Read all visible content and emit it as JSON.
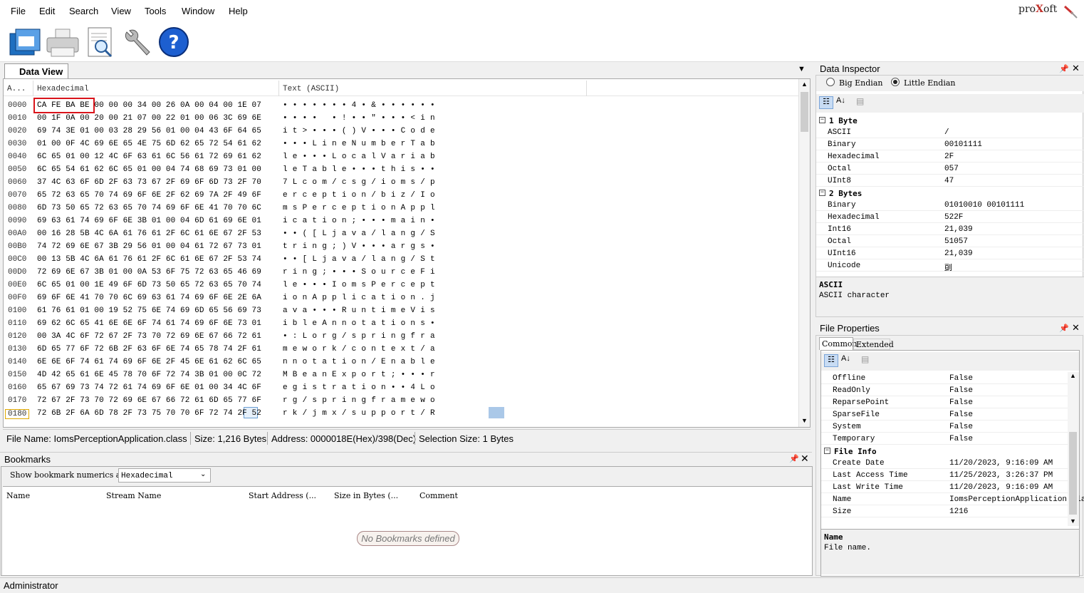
{
  "menu": [
    "File",
    "Edit",
    "Search",
    "View",
    "Tools",
    "Window",
    "Help"
  ],
  "logo": {
    "pre": "pro",
    "x": "X",
    "post": "oft"
  },
  "toolbar": [
    "open-icon",
    "print-icon",
    "preview-icon",
    "tools-icon",
    "help-icon"
  ],
  "dataview": {
    "tab": "Data View",
    "col_addr": "A...",
    "col_hex": "Hexadecimal",
    "col_text": "Text (ASCII)",
    "rows": [
      {
        "a": "0000",
        "h": "CA FE BA BE 00 00 00 34 00 26 0A 00 04 00 1E 07",
        "t": "• • • • • • • 4 • & • • • • • •"
      },
      {
        "a": "0010",
        "h": "00 1F 0A 00 20 00 21 07 00 22 01 00 06 3C 69 6E",
        "t": "• • • •   • ! • • \" • • • < i n"
      },
      {
        "a": "0020",
        "h": "69 74 3E 01 00 03 28 29 56 01 00 04 43 6F 64 65",
        "t": "i t > • • • ( ) V • • • C o d e"
      },
      {
        "a": "0030",
        "h": "01 00 0F 4C 69 6E 65 4E 75 6D 62 65 72 54 61 62",
        "t": "• • • L i n e N u m b e r T a b"
      },
      {
        "a": "0040",
        "h": "6C 65 01 00 12 4C 6F 63 61 6C 56 61 72 69 61 62",
        "t": "l e • • • L o c a l V a r i a b"
      },
      {
        "a": "0050",
        "h": "6C 65 54 61 62 6C 65 01 00 04 74 68 69 73 01 00",
        "t": "l e T a b l e • • • t h i s • •"
      },
      {
        "a": "0060",
        "h": "37 4C 63 6F 6D 2F 63 73 67 2F 69 6F 6D 73 2F 70",
        "t": "7 L c o m / c s g / i o m s / p"
      },
      {
        "a": "0070",
        "h": "65 72 63 65 70 74 69 6F 6E 2F 62 69 7A 2F 49 6F",
        "t": "e r c e p t i o n / b i z / I o"
      },
      {
        "a": "0080",
        "h": "6D 73 50 65 72 63 65 70 74 69 6F 6E 41 70 70 6C",
        "t": "m s P e r c e p t i o n A p p l"
      },
      {
        "a": "0090",
        "h": "69 63 61 74 69 6F 6E 3B 01 00 04 6D 61 69 6E 01",
        "t": "i c a t i o n ; • • • m a i n •"
      },
      {
        "a": "00A0",
        "h": "00 16 28 5B 4C 6A 61 76 61 2F 6C 61 6E 67 2F 53",
        "t": "• • ( [ L j a v a / l a n g / S"
      },
      {
        "a": "00B0",
        "h": "74 72 69 6E 67 3B 29 56 01 00 04 61 72 67 73 01",
        "t": "t r i n g ; ) V • • • a r g s •"
      },
      {
        "a": "00C0",
        "h": "00 13 5B 4C 6A 61 76 61 2F 6C 61 6E 67 2F 53 74",
        "t": "• • [ L j a v a / l a n g / S t"
      },
      {
        "a": "00D0",
        "h": "72 69 6E 67 3B 01 00 0A 53 6F 75 72 63 65 46 69",
        "t": "r i n g ; • • • S o u r c e F i"
      },
      {
        "a": "00E0",
        "h": "6C 65 01 00 1E 49 6F 6D 73 50 65 72 63 65 70 74",
        "t": "l e • • • I o m s P e r c e p t"
      },
      {
        "a": "00F0",
        "h": "69 6F 6E 41 70 70 6C 69 63 61 74 69 6F 6E 2E 6A",
        "t": "i o n A p p l i c a t i o n . j"
      },
      {
        "a": "0100",
        "h": "61 76 61 01 00 19 52 75 6E 74 69 6D 65 56 69 73",
        "t": "a v a • • • R u n t i m e V i s"
      },
      {
        "a": "0110",
        "h": "69 62 6C 65 41 6E 6E 6F 74 61 74 69 6F 6E 73 01",
        "t": "i b l e A n n o t a t i o n s •"
      },
      {
        "a": "0120",
        "h": "00 3A 4C 6F 72 67 2F 73 70 72 69 6E 67 66 72 61",
        "t": "• : L o r g / s p r i n g f r a"
      },
      {
        "a": "0130",
        "h": "6D 65 77 6F 72 6B 2F 63 6F 6E 74 65 78 74 2F 61",
        "t": "m e w o r k / c o n t e x t / a"
      },
      {
        "a": "0140",
        "h": "6E 6E 6F 74 61 74 69 6F 6E 2F 45 6E 61 62 6C 65",
        "t": "n n o t a t i o n / E n a b l e"
      },
      {
        "a": "0150",
        "h": "4D 42 65 61 6E 45 78 70 6F 72 74 3B 01 00 0C 72",
        "t": "M B e a n E x p o r t ; • • • r"
      },
      {
        "a": "0160",
        "h": "65 67 69 73 74 72 61 74 69 6F 6E 01 00 34 4C 6F",
        "t": "e g i s t r a t i o n • • 4 L o"
      },
      {
        "a": "0170",
        "h": "72 67 2F 73 70 72 69 6E 67 66 72 61 6D 65 77 6F",
        "t": "r g / s p r i n g f r a m e w o"
      },
      {
        "a": "0180",
        "h": "72 6B 2F 6A 6D 78 2F 73 75 70 70 6F 72 74 2F 52",
        "t": "r k / j m x / s u p p o r t / R"
      }
    ]
  },
  "status": {
    "filename": "File Name: IomsPerceptionApplication.class",
    "size": "Size: 1,216 Bytes",
    "address": "Address: 0000018E(Hex)/398(Dec)",
    "selection": "Selection Size: 1 Bytes"
  },
  "bookmarks": {
    "title": "Bookmarks",
    "show_label": "Show bookmark numerics as",
    "numerics_value": "Hexadecimal",
    "columns": [
      "Name",
      "Stream Name",
      "Start Address (...",
      "Size in Bytes (...",
      "Comment"
    ],
    "empty_text": "No Bookmarks defined"
  },
  "inspector": {
    "title": "Data Inspector",
    "big_endian": "Big Endian",
    "little_endian": "Little Endian",
    "group1": "1 Byte",
    "group1_rows": [
      [
        "ASCII",
        "/"
      ],
      [
        "Binary",
        "00101111"
      ],
      [
        "Hexadecimal",
        "2F"
      ],
      [
        "Octal",
        "057"
      ],
      [
        "UInt8",
        "47"
      ]
    ],
    "group2": "2 Bytes",
    "group2_rows": [
      [
        "Binary",
        "01010010 00101111"
      ],
      [
        "Hexadecimal",
        "522F"
      ],
      [
        "Int16",
        "21,039"
      ],
      [
        "Octal",
        "51057"
      ],
      [
        "UInt16",
        "21,039"
      ],
      [
        "Unicode",
        "刯"
      ]
    ],
    "desc_title": "ASCII",
    "desc_text": "ASCII character"
  },
  "fileprops": {
    "title": "File Properties",
    "tab_common": "Common",
    "tab_extended": "Extended",
    "rows": [
      [
        "Offline",
        "False"
      ],
      [
        "ReadOnly",
        "False"
      ],
      [
        "ReparsePoint",
        "False"
      ],
      [
        "SparseFile",
        "False"
      ],
      [
        "System",
        "False"
      ],
      [
        "Temporary",
        "False"
      ]
    ],
    "group": "File Info",
    "info_rows": [
      [
        "Create Date",
        "11/20/2023, 9:16:09 AM"
      ],
      [
        "Last Access Time",
        "11/25/2023, 3:26:37 PM"
      ],
      [
        "Last Write Time",
        "11/20/2023, 9:16:09 AM"
      ],
      [
        "Name",
        "IomsPerceptionApplication.cla"
      ],
      [
        "Size",
        "1216"
      ]
    ],
    "desc_title": "Name",
    "desc_text": "File name."
  },
  "bottom_status": "Administrator"
}
